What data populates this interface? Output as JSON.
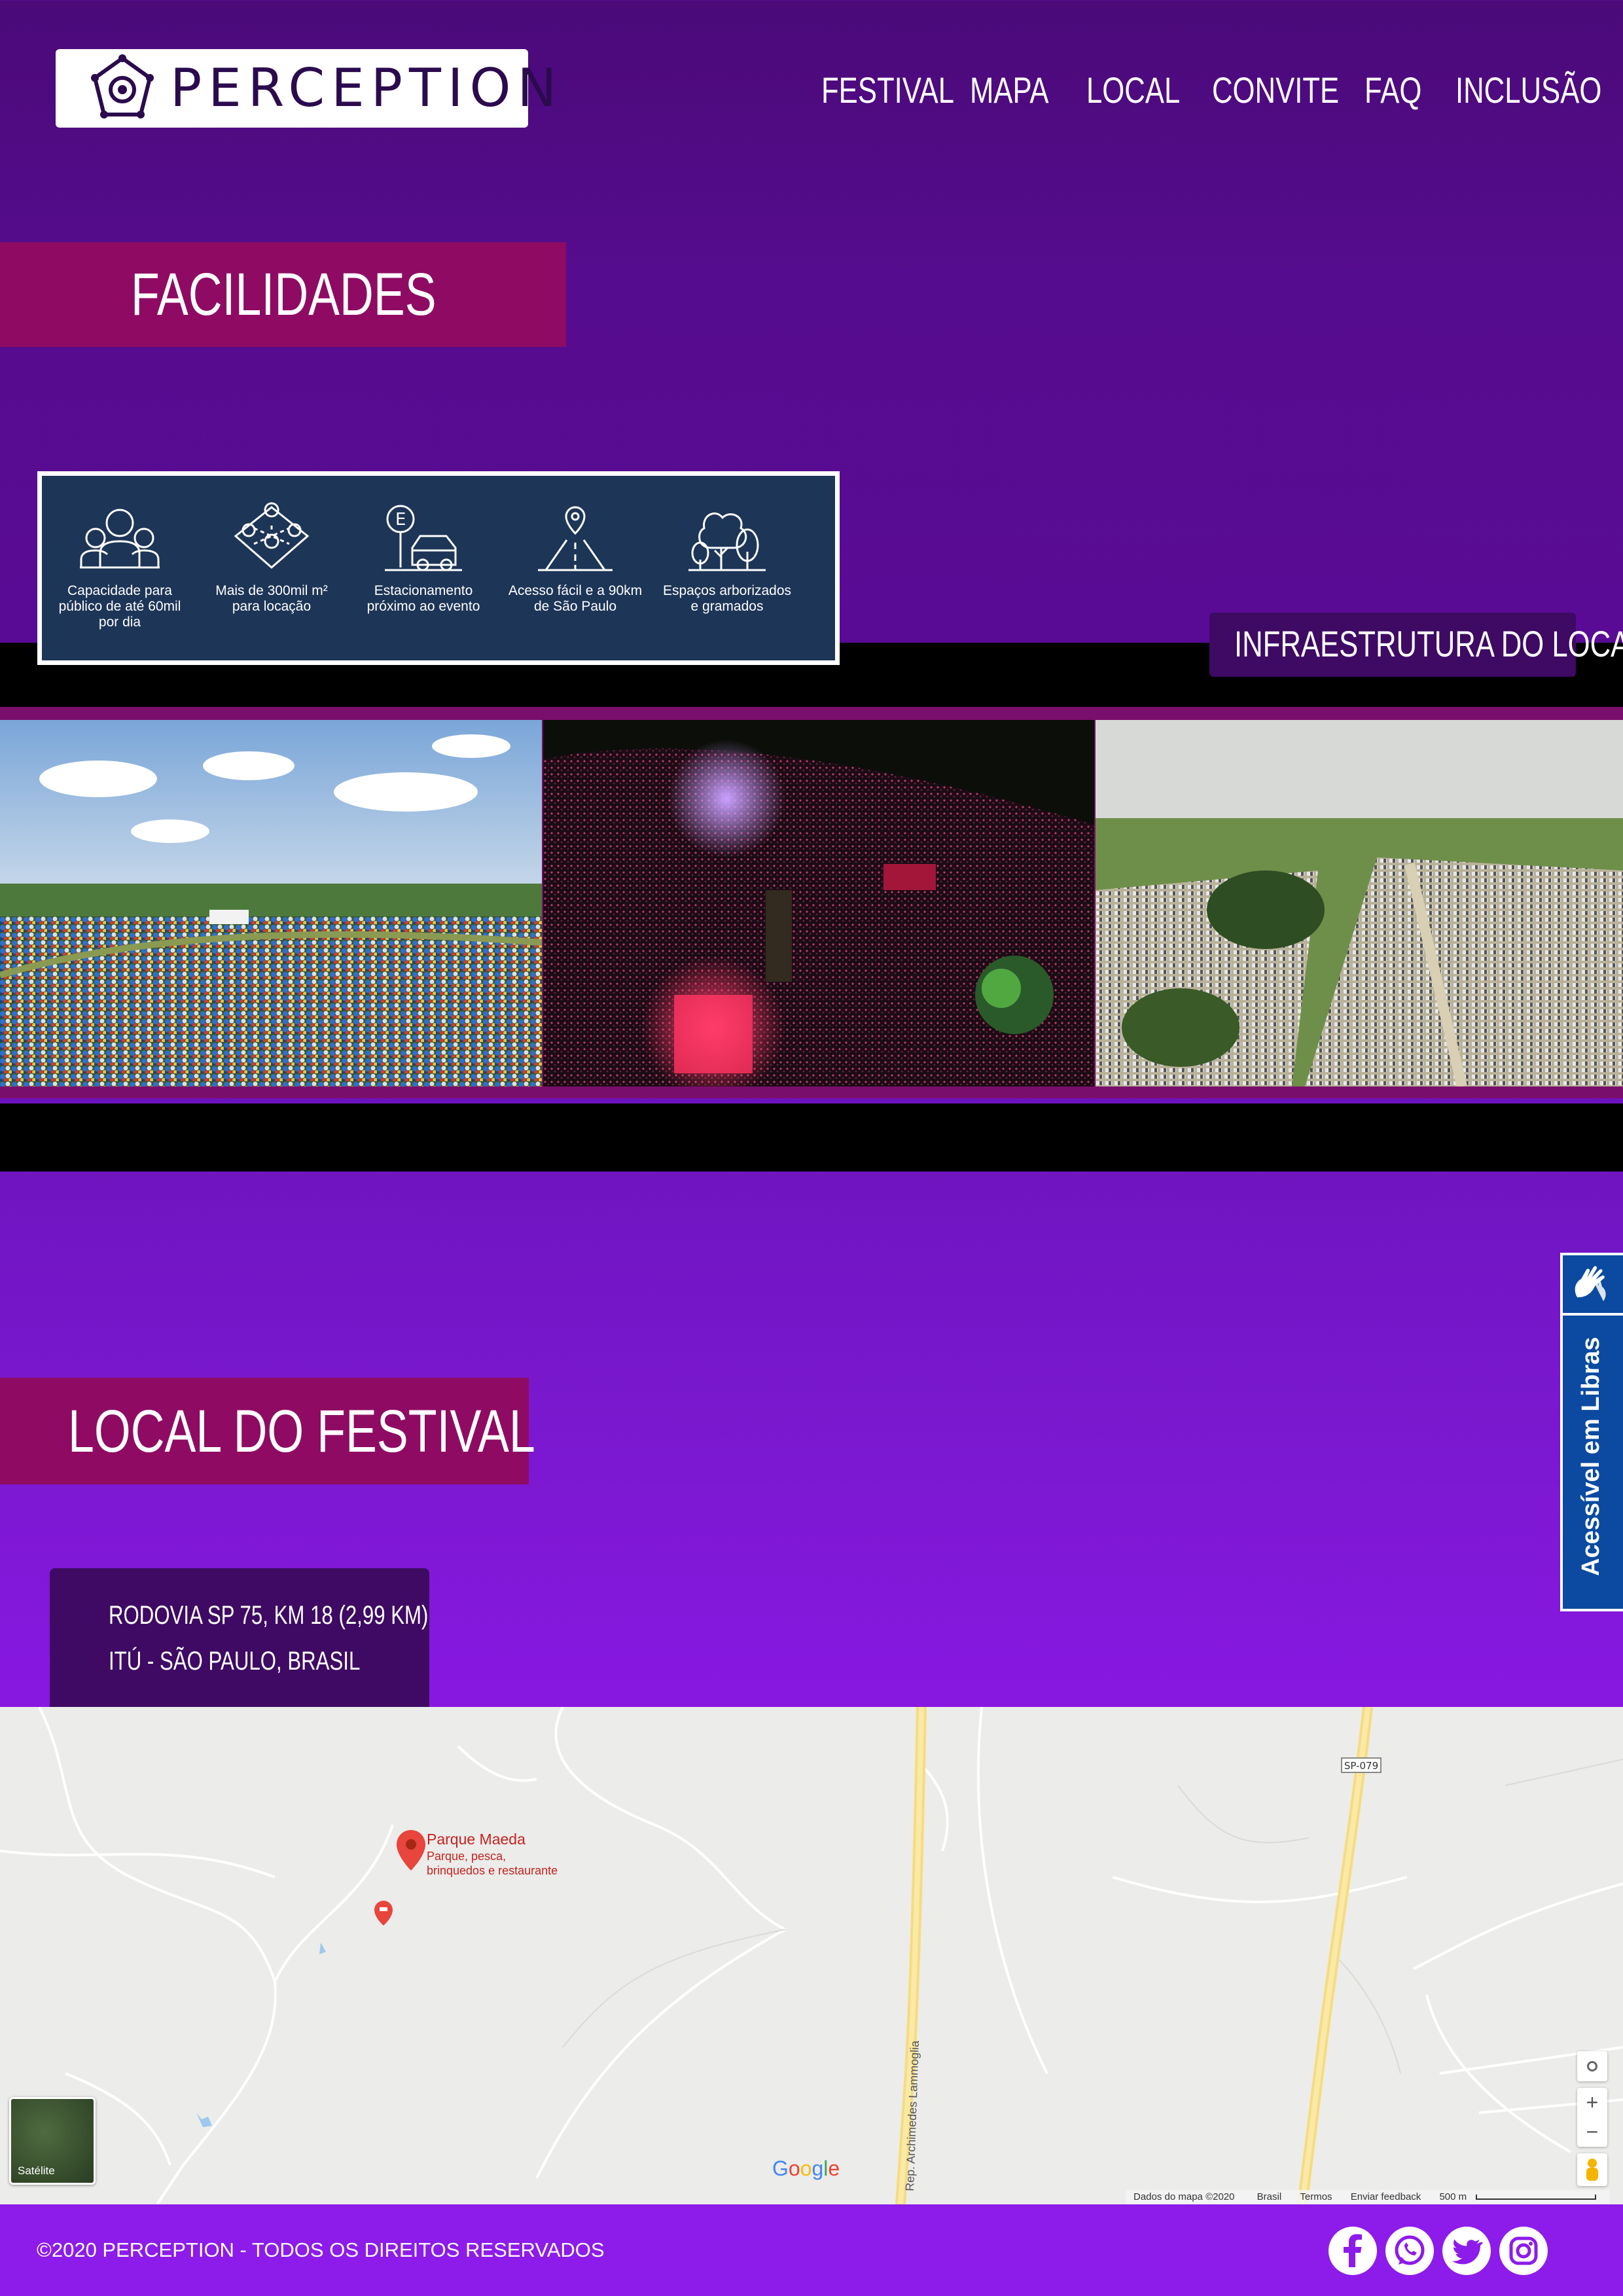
{
  "header": {
    "logo_text": "PERCEPTION",
    "nav": [
      "FESTIVAL",
      "MAPA",
      "LOCAL",
      "CONVITE",
      "FAQ",
      "INCLUSÃO"
    ]
  },
  "facilities": {
    "title": "FACILIDADES",
    "items": [
      {
        "icon": "people-icon",
        "label": "Capacidade para público de até 60mil por dia"
      },
      {
        "icon": "map-pin-area-icon",
        "label": "Mais de 300mil m² para locação"
      },
      {
        "icon": "parking-car-icon",
        "label": "Estacionamento próximo ao evento"
      },
      {
        "icon": "road-location-icon",
        "label": "Acesso fácil e a 90km de São Paulo"
      },
      {
        "icon": "trees-icon",
        "label": "Espaços arborizados e gramados"
      }
    ],
    "infra_tag": "INFRAESTRUTURA DO LOCAL"
  },
  "photos": [
    {
      "name": "photo-camping-tents"
    },
    {
      "name": "photo-night-stage-crowd"
    },
    {
      "name": "photo-parking-lot"
    }
  ],
  "location": {
    "title": "LOCAL DO FESTIVAL",
    "address_line1": "RODOVIA SP 75, KM 18 (2,99 KM)",
    "address_line2": "ITÚ  - SÃO PAULO,  BRASIL"
  },
  "map": {
    "place_name": "Parque Maeda",
    "place_desc_line1": "Parque, pesca,",
    "place_desc_line2": "brinquedos e restaurante",
    "road_label": "SP-079",
    "street_label": "Rep. Archimedes Lammoglia",
    "satellite_label": "Satélite",
    "google_label": "Google",
    "attribution": "Dados do mapa ©2020",
    "country": "Brasil",
    "terms": "Termos",
    "feedback": "Enviar feedback",
    "scale": "500 m",
    "zoom_in": "+",
    "zoom_out": "−"
  },
  "libras": {
    "label": "Acessível em Libras"
  },
  "footer": {
    "copyright": "©2020 PERCEPTION - TODOS OS DIREITOS RESERVADOS",
    "social": [
      "facebook-icon",
      "whatsapp-icon",
      "twitter-icon",
      "instagram-icon"
    ]
  },
  "colors": {
    "accent_pill": "#8f0b63",
    "facility_box": "#1d3557",
    "libras_blue": "#0b4aa0"
  }
}
